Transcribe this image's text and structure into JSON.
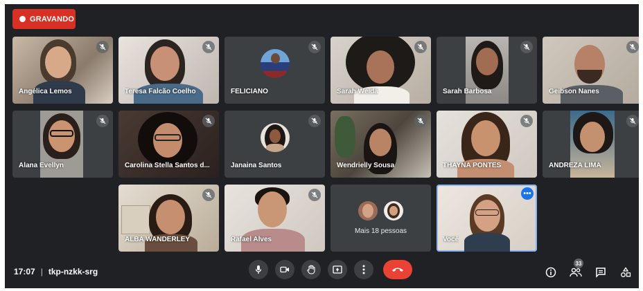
{
  "recording": {
    "label": "GRAVANDO"
  },
  "participants": [
    {
      "name": "Angélica Lemos"
    },
    {
      "name": "Teresa Falcão Coelho"
    },
    {
      "name": "FELICIANO"
    },
    {
      "name": "Sarah Weida"
    },
    {
      "name": "Sarah Barbosa"
    },
    {
      "name": "Geibson Nanes"
    },
    {
      "name": "Alana Evellyn"
    },
    {
      "name": "Carolina Stella Santos d..."
    },
    {
      "name": "Janaina Santos"
    },
    {
      "name": "Wendrielly Sousa"
    },
    {
      "name": "THAYNA PONTES"
    },
    {
      "name": "ANDREZA LIMA"
    },
    {
      "name": "ALBA WANDERLEY"
    },
    {
      "name": "Rafael Alves"
    },
    {
      "name": "Você"
    }
  ],
  "more_tile": {
    "label": "Mais 18 pessoas"
  },
  "meeting": {
    "time": "17:07",
    "separator": "|",
    "code": "tkp-nzkk-srg"
  },
  "people_count": "33",
  "icons": {
    "mic": "mic-icon",
    "camera": "camera-icon",
    "raise_hand": "hand-icon",
    "present": "present-icon",
    "more": "more-vert-icon",
    "end_call": "end-call-icon",
    "info": "info-icon",
    "people": "people-icon",
    "chat": "chat-icon",
    "activities": "activities-icon"
  },
  "colors": {
    "background": "#202124",
    "tile": "#3c4043",
    "end_call": "#ea4335",
    "recording": "#d93025",
    "self_border": "#8ab4f8"
  }
}
